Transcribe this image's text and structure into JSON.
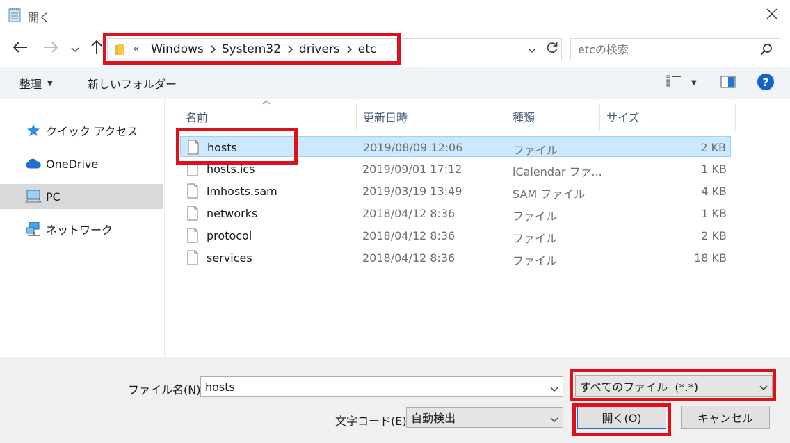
{
  "window": {
    "title": "開く"
  },
  "address": {
    "overflow_chevron": "«",
    "breadcrumbs": [
      "Windows",
      "System32",
      "drivers",
      "etc"
    ]
  },
  "search": {
    "placeholder": "etcの検索"
  },
  "toolbar": {
    "organize_label": "整理",
    "new_folder_label": "新しいフォルダー"
  },
  "nav": {
    "items": [
      {
        "label": "クイック アクセス",
        "icon": "star-icon"
      },
      {
        "label": "OneDrive",
        "icon": "cloud-icon"
      },
      {
        "label": "PC",
        "icon": "computer-icon",
        "selected": true
      },
      {
        "label": "ネットワーク",
        "icon": "network-icon"
      }
    ]
  },
  "columns": {
    "name": "名前",
    "date": "更新日時",
    "type": "種類",
    "size": "サイズ"
  },
  "files": [
    {
      "name": "hosts",
      "date": "2019/08/09 12:06",
      "type": "ファイル",
      "size": "2 KB",
      "selected": true
    },
    {
      "name": "hosts.ics",
      "date": "2019/09/01 17:12",
      "type": "iCalendar ファ...",
      "size": "1 KB"
    },
    {
      "name": "lmhosts.sam",
      "date": "2019/03/19 13:49",
      "type": "SAM ファイル",
      "size": "4 KB"
    },
    {
      "name": "networks",
      "date": "2018/04/12 8:36",
      "type": "ファイル",
      "size": "1 KB"
    },
    {
      "name": "protocol",
      "date": "2018/04/12 8:36",
      "type": "ファイル",
      "size": "2 KB"
    },
    {
      "name": "services",
      "date": "2018/04/12 8:36",
      "type": "ファイル",
      "size": "18 KB"
    }
  ],
  "bottom": {
    "filename_label": "ファイル名(N):",
    "filename_value": "hosts",
    "filetype_value": "すべてのファイル  (*.*)",
    "encoding_label": "文字コード(E):",
    "encoding_value": "自動検出",
    "open_button": "開く(O)",
    "cancel_button": "キャンセル"
  },
  "colors": {
    "highlight": "#e0101a",
    "selection": "#cce8ff",
    "accent": "#0078d7"
  }
}
